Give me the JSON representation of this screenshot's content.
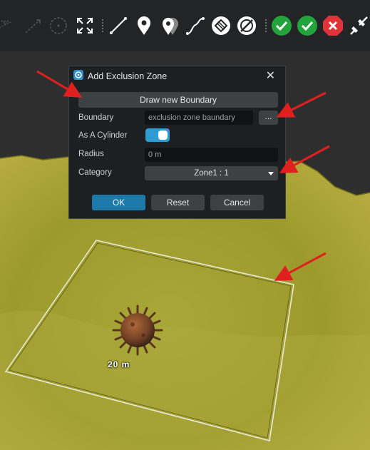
{
  "toolbar": {
    "icons": [
      "rotate-icon",
      "measure-icon",
      "circle-tool-icon",
      "fullscreen-icon",
      "line-tool-icon",
      "placemark-icon",
      "multi-placemark-icon",
      "path-tool-icon",
      "exclusion-zone-icon",
      "no-zone-icon",
      "accept-icon",
      "accept-all-icon",
      "reject-icon",
      "disconnect-icon"
    ],
    "colors": {
      "accept": "#22a33b",
      "reject": "#e0333a"
    }
  },
  "dialog": {
    "title": "Add Exclusion Zone",
    "close_glyph": "✕",
    "draw_button": "Draw new Boundary",
    "boundary_label": "Boundary",
    "boundary_value": "exclusion zone baundary",
    "browse_button": "...",
    "cylinder_label": "As A Cylinder",
    "cylinder_on": true,
    "radius_label": "Radius",
    "radius_value": "0 m",
    "category_label": "Category",
    "category_value": "Zone1 : 1",
    "ok_button": "OK",
    "reset_button": "Reset",
    "cancel_button": "Cancel"
  },
  "scene": {
    "scale_label": "20 m",
    "colors": {
      "terrain": "#a6a330",
      "sky": "#2e2e2e",
      "zone_outline": "#e9e9d6",
      "annotation_arrow": "#e0201e"
    }
  }
}
